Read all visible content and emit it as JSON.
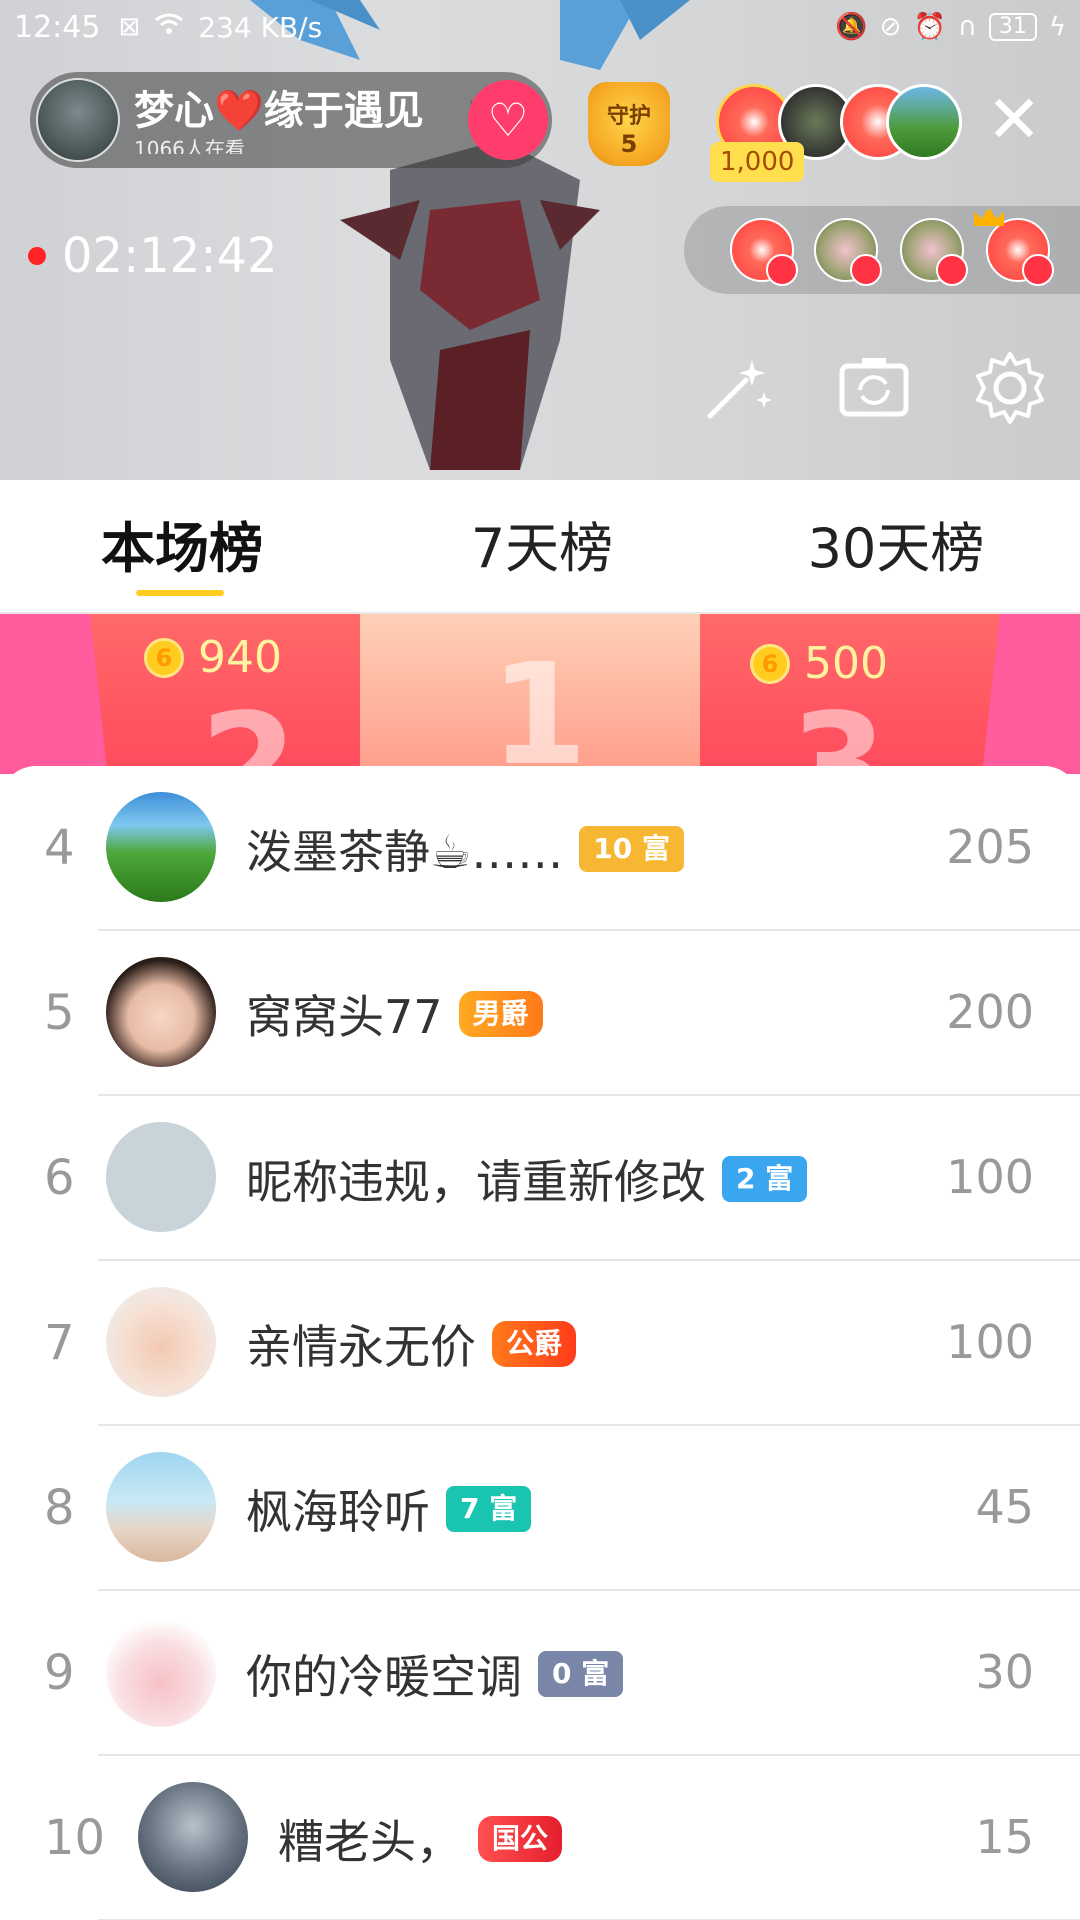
{
  "status_bar": {
    "time": "12:45",
    "net_speed": "234 KB/s",
    "battery": "31"
  },
  "host": {
    "name": "梦心❤️缘于遇见",
    "viewers": "1066人在看",
    "follow_icon": "heart-plus-icon"
  },
  "guard": {
    "label": "守护",
    "count": "5"
  },
  "viewer_strip": {
    "coin_count": "1,000"
  },
  "live": {
    "duration": "02:12:42"
  },
  "tabs": [
    {
      "label": "本场榜",
      "active": true
    },
    {
      "label": "7天榜",
      "active": false
    },
    {
      "label": "30天榜",
      "active": false
    }
  ],
  "podium": {
    "second": {
      "rank": "2",
      "score": "940"
    },
    "first": {
      "rank": "1"
    },
    "third": {
      "rank": "3",
      "score": "500"
    }
  },
  "ranking": [
    {
      "rank": "4",
      "name": "泼墨茶静☕……",
      "badge": "10 富",
      "score": "205"
    },
    {
      "rank": "5",
      "name": "窝窝头77",
      "badge": "男爵",
      "score": "200"
    },
    {
      "rank": "6",
      "name": "昵称违规，请重新修改",
      "badge": "2 富",
      "score": "100"
    },
    {
      "rank": "7",
      "name": "亲情永无价",
      "badge": "公爵",
      "score": "100"
    },
    {
      "rank": "8",
      "name": "枫海聆听",
      "badge": "7 富",
      "score": "45"
    },
    {
      "rank": "9",
      "name": "你的冷暖空调",
      "badge": "0 富",
      "score": "30"
    },
    {
      "rank": "10",
      "name": "糟老头，",
      "badge": "国公",
      "score": "15"
    }
  ],
  "colors": {
    "accent": "#ffcc1f",
    "podium_pink": "#ff5a9c",
    "follow_red": "#ff3d6c"
  }
}
